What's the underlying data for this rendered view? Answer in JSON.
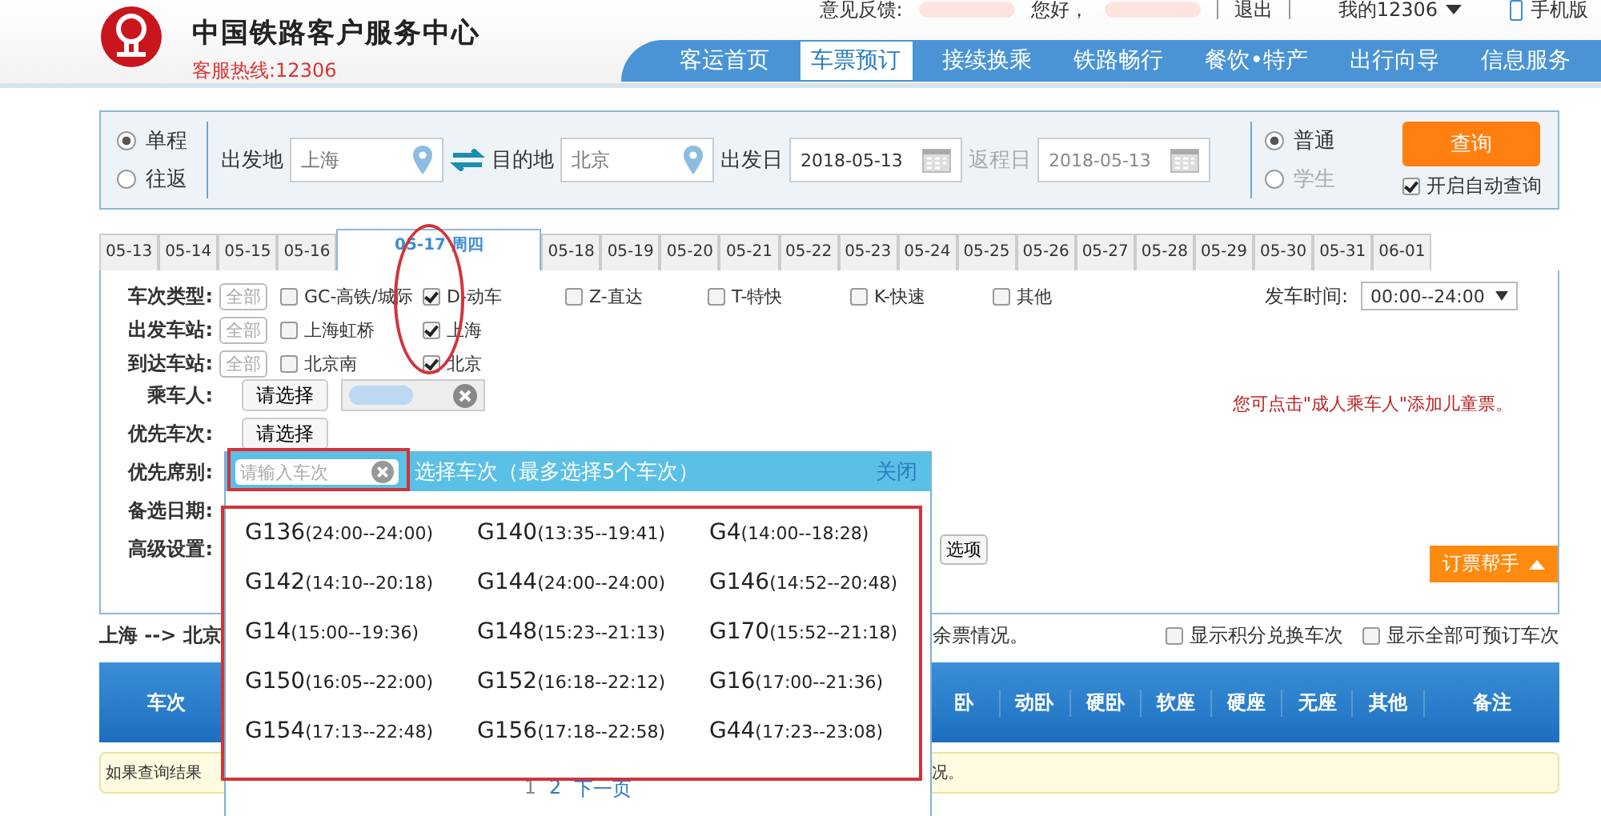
{
  "header": {
    "title": "中国铁路客户服务中心",
    "hotline": "客服热线:12306",
    "top_links": [
      {
        "kind": "text",
        "label": "意见反馈:"
      },
      {
        "kind": "blur"
      },
      {
        "kind": "text",
        "label": "您好，"
      },
      {
        "kind": "blur"
      },
      {
        "kind": "link",
        "label": "退出"
      },
      {
        "kind": "menu",
        "label": "我的12306"
      },
      {
        "kind": "phone",
        "label": "手机版"
      }
    ],
    "nav": [
      {
        "label": "客运首页",
        "selected": false
      },
      {
        "label": "车票预订",
        "selected": true
      },
      {
        "label": "接续换乘",
        "selected": false
      },
      {
        "label": "铁路畅行",
        "selected": false
      },
      {
        "label": "餐饮•特产",
        "selected": false
      },
      {
        "label": "出行向导",
        "selected": false
      },
      {
        "label": "信息服务",
        "selected": false
      }
    ]
  },
  "search": {
    "trip_types": [
      {
        "label": "单程",
        "selected": true
      },
      {
        "label": "往返",
        "selected": false
      }
    ],
    "from": {
      "label": "出发地",
      "value": "上海"
    },
    "to": {
      "label": "目的地",
      "value": "北京"
    },
    "depart": {
      "label": "出发日",
      "value": "2018-05-13",
      "disabled": false
    },
    "return": {
      "label": "返程日",
      "value": "2018-05-13",
      "disabled": true
    },
    "ticket_types": [
      {
        "label": "普通",
        "selected": true,
        "disabled": false
      },
      {
        "label": "学生",
        "selected": false,
        "disabled": true
      }
    ],
    "query_button": "查询",
    "auto_query": {
      "label": "开启自动查询",
      "checked": true
    }
  },
  "date_tabs": [
    {
      "label": "05-13",
      "selected": false
    },
    {
      "label": "05-14",
      "selected": false
    },
    {
      "label": "05-15",
      "selected": false
    },
    {
      "label": "05-16",
      "selected": false
    },
    {
      "label": "05-17 周四",
      "selected": true
    },
    {
      "label": "05-18",
      "selected": false
    },
    {
      "label": "05-19",
      "selected": false
    },
    {
      "label": "05-20",
      "selected": false
    },
    {
      "label": "05-21",
      "selected": false
    },
    {
      "label": "05-22",
      "selected": false
    },
    {
      "label": "05-23",
      "selected": false
    },
    {
      "label": "05-24",
      "selected": false
    },
    {
      "label": "05-25",
      "selected": false
    },
    {
      "label": "05-26",
      "selected": false
    },
    {
      "label": "05-27",
      "selected": false
    },
    {
      "label": "05-28",
      "selected": false
    },
    {
      "label": "05-29",
      "selected": false
    },
    {
      "label": "05-30",
      "selected": false
    },
    {
      "label": "05-31",
      "selected": false
    },
    {
      "label": "06-01",
      "selected": false
    }
  ],
  "filters": {
    "rows": [
      {
        "label": "车次类型:",
        "all": "全部",
        "options": [
          {
            "label": "GC-高铁/城际",
            "checked": false
          },
          {
            "label": "D-动车",
            "checked": true
          },
          {
            "label": "Z-直达",
            "checked": false
          },
          {
            "label": "T-特快",
            "checked": false
          },
          {
            "label": "K-快速",
            "checked": false
          },
          {
            "label": "其他",
            "checked": false
          }
        ]
      },
      {
        "label": "出发车站:",
        "all": "全部",
        "options": [
          {
            "label": "上海虹桥",
            "checked": false
          },
          {
            "label": "上海",
            "checked": true
          }
        ]
      },
      {
        "label": "到达车站:",
        "all": "全部",
        "options": [
          {
            "label": "北京南",
            "checked": false
          },
          {
            "label": "北京",
            "checked": true
          }
        ]
      }
    ],
    "departure_time": {
      "label": "发车时间:",
      "value": "00:00--24:00"
    },
    "passenger": {
      "label": "乘车人:",
      "button": "请选择"
    },
    "notice": "您可点击\"成人乘车人\"添加儿童票。",
    "priority_train": {
      "label": "优先车次:",
      "button": "请选择"
    },
    "seat_label": "优先席别:",
    "backup_date_label": "备选日期:",
    "advanced_label": "高级设置:",
    "advanced_button_tail": "选项",
    "helper_button": "订票帮手"
  },
  "result": {
    "route": "上海 --> 北京",
    "note_tail": "余票情况。",
    "options": [
      {
        "label": "显示积分兑换车次",
        "checked": false
      },
      {
        "label": "显示全部可预订车次",
        "checked": false
      }
    ],
    "columns": [
      "车次",
      "卧",
      "动卧",
      "硬卧",
      "软座",
      "硬座",
      "无座",
      "其他",
      "备注"
    ],
    "notice_head": "如果查询结果",
    "notice_tail": "况。"
  },
  "popup": {
    "placeholder": "请输入车次",
    "title": "选择车次（最多选择5个车次）",
    "close": "关闭",
    "trains": [
      {
        "code": "G136",
        "time": "(24:00--24:00)"
      },
      {
        "code": "G140",
        "time": "(13:35--19:41)"
      },
      {
        "code": "G4",
        "time": "(14:00--18:28)"
      },
      {
        "code": "G142",
        "time": "(14:10--20:18)"
      },
      {
        "code": "G144",
        "time": "(24:00--24:00)"
      },
      {
        "code": "G146",
        "time": "(14:52--20:48)"
      },
      {
        "code": "G14",
        "time": "(15:00--19:36)"
      },
      {
        "code": "G148",
        "time": "(15:23--21:13)"
      },
      {
        "code": "G170",
        "time": "(15:52--21:18)"
      },
      {
        "code": "G150",
        "time": "(16:05--22:00)"
      },
      {
        "code": "G152",
        "time": "(16:18--22:12)"
      },
      {
        "code": "G16",
        "time": "(17:00--21:36)"
      },
      {
        "code": "G154",
        "time": "(17:13--22:48)"
      },
      {
        "code": "G156",
        "time": "(17:18--22:58)"
      },
      {
        "code": "G44",
        "time": "(17:23--23:08)"
      }
    ],
    "pages": [
      {
        "label": "1",
        "selected": true
      },
      {
        "label": "2",
        "selected": false
      }
    ],
    "next": "下一页"
  }
}
